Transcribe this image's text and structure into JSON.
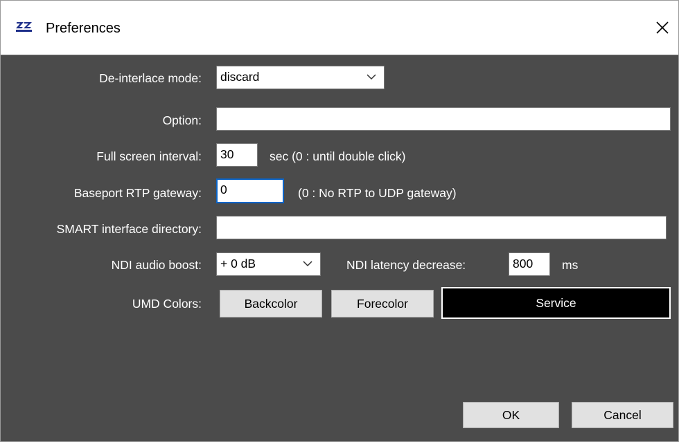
{
  "window": {
    "title": "Preferences",
    "app_icon": "zz-logo-icon",
    "close_icon": "close-icon"
  },
  "form": {
    "deinterlace": {
      "label": "De-interlace mode:",
      "value": "discard"
    },
    "option": {
      "label": "Option:",
      "value": ""
    },
    "fullscreen": {
      "label": "Full screen interval:",
      "value": "30",
      "hint": "sec (0 : until double click)"
    },
    "baseport": {
      "label": "Baseport RTP gateway:",
      "value": "0",
      "hint": "(0 : No RTP to UDP gateway)"
    },
    "smart": {
      "label": "SMART interface directory:",
      "value": ""
    },
    "ndi_boost": {
      "label": "NDI audio boost:",
      "value": "+ 0 dB"
    },
    "ndi_latency": {
      "label": "NDI latency decrease:",
      "value": "800",
      "unit": "ms"
    },
    "umd": {
      "label": "UMD Colors:",
      "backcolor": "Backcolor",
      "forecolor": "Forecolor",
      "service": "Service"
    }
  },
  "footer": {
    "ok": "OK",
    "cancel": "Cancel"
  },
  "colors": {
    "background": "#4b4b4b",
    "focus_border": "#0a64c8",
    "button": "#e1e1e1",
    "service_bg": "#000000"
  }
}
